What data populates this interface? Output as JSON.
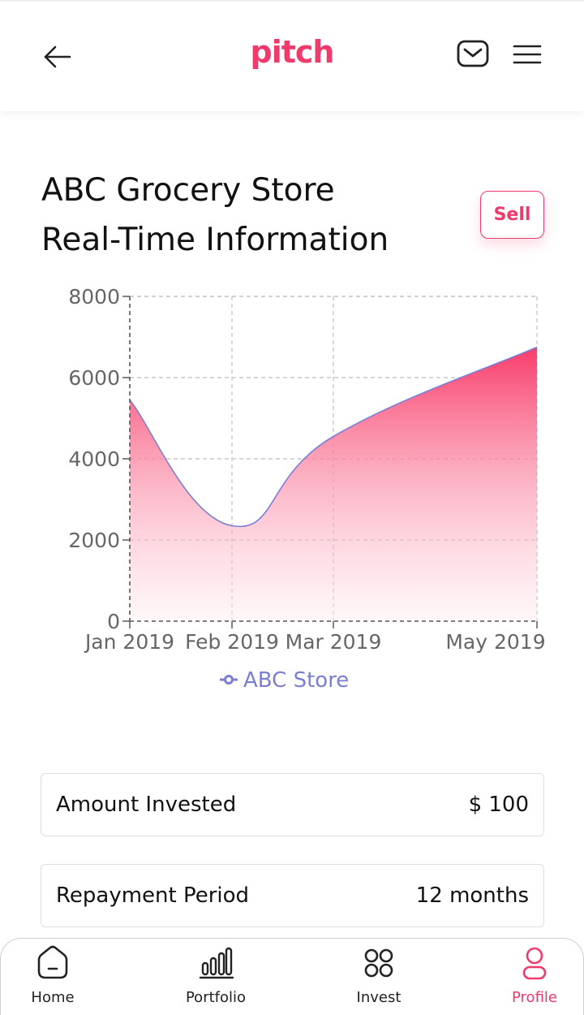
{
  "header": {
    "logo_text": "pitch",
    "back_icon": "arrow-left-icon",
    "mail_icon": "mail-icon",
    "menu_icon": "hamburger-menu-icon"
  },
  "title": {
    "line1": "ABC Grocery Store",
    "line2": "Real-Time Information"
  },
  "sell_button": {
    "label": "Sell"
  },
  "colors": {
    "brand": "#f03a6b",
    "series_line": "#7b7fd4",
    "text": "#111111"
  },
  "chart_data": {
    "type": "area",
    "x": [
      "Jan 2019",
      "Feb 2019",
      "Mar 2019",
      "May 2019"
    ],
    "x_tick_labels": [
      "Jan 2019",
      "Feb 2019",
      "Mar 2019",
      "May 2019"
    ],
    "y_tick_labels": [
      "0",
      "2000",
      "4000",
      "6000",
      "8000"
    ],
    "ylim": [
      0,
      8000
    ],
    "grid": true,
    "series": [
      {
        "name": "ABC Store",
        "values": [
          5450,
          2350,
          4550,
          6750
        ]
      }
    ],
    "legend_position": "bottom-center",
    "curve": "smooth"
  },
  "info": [
    {
      "label": "Amount Invested",
      "value": "$ 100"
    },
    {
      "label": "Repayment Period",
      "value": "12 months"
    }
  ],
  "nav": [
    {
      "label": "Home",
      "icon": "home-icon",
      "active": false
    },
    {
      "label": "Portfolio",
      "icon": "bar-chart-icon",
      "active": false
    },
    {
      "label": "Invest",
      "icon": "grid-circles-icon",
      "active": false
    },
    {
      "label": "Profile",
      "icon": "user-icon",
      "active": true
    }
  ]
}
